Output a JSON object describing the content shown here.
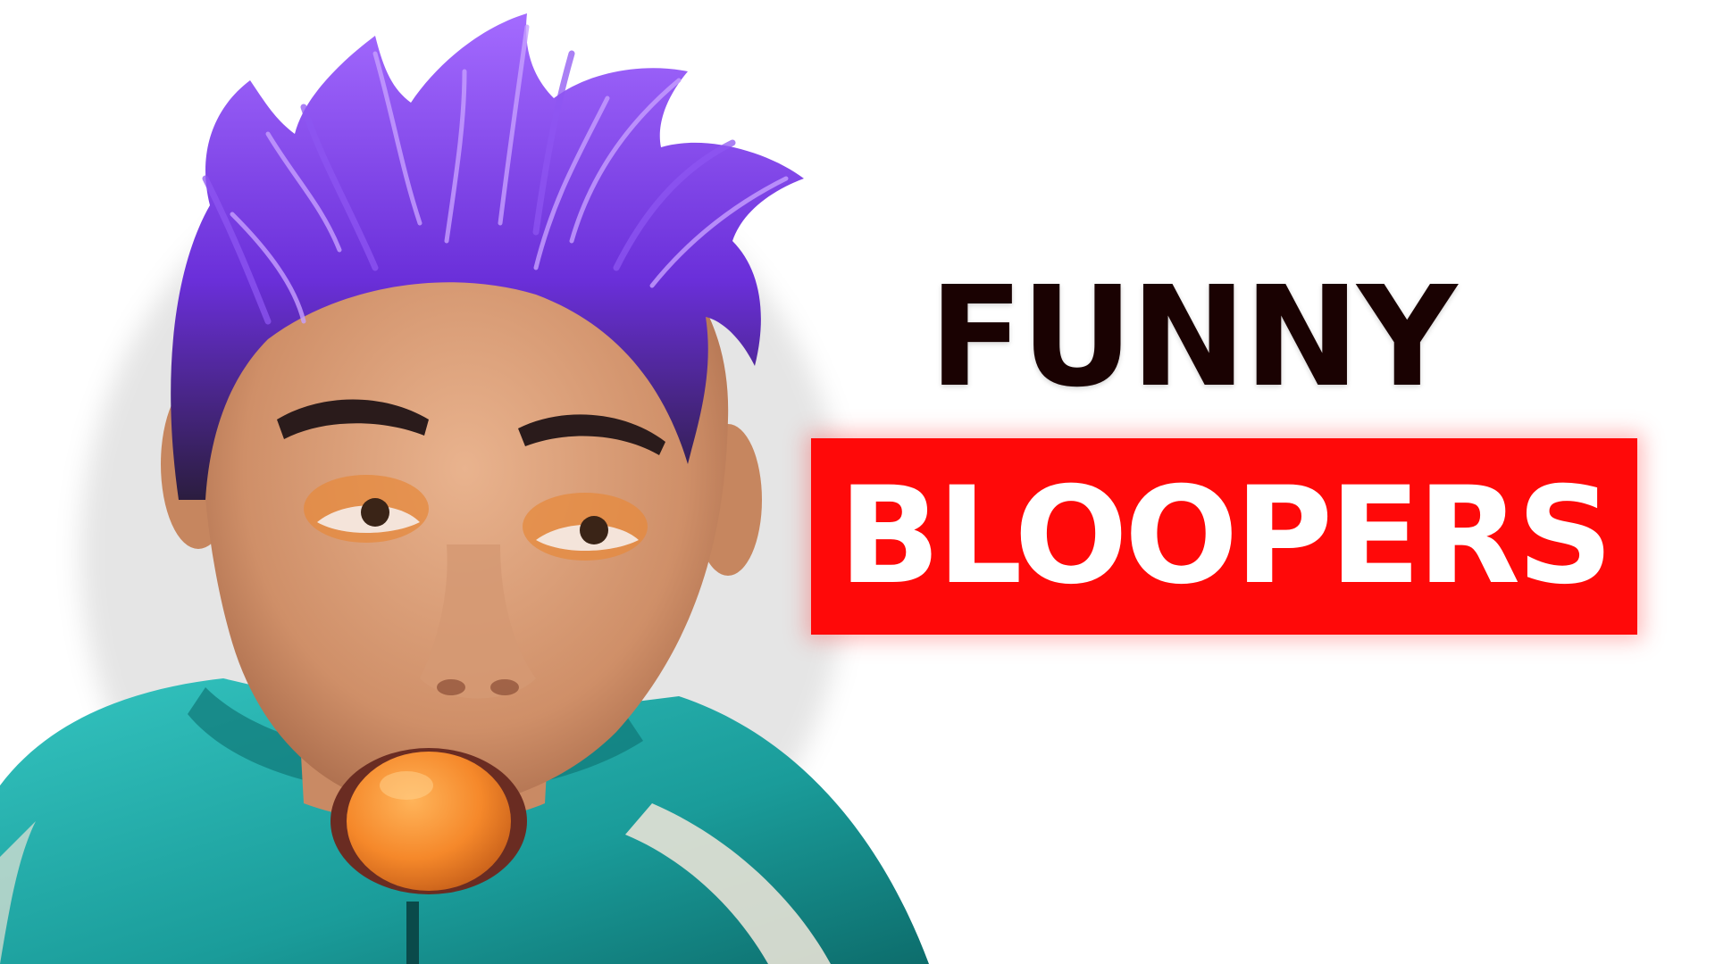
{
  "thumbnail": {
    "title_line1": "FUNNY",
    "title_line2": "BLOOPERS",
    "colors": {
      "background": "#ffffff",
      "title_line1": "#1a0202",
      "banner": "#ff0909",
      "title_line2": "#ffffff",
      "hair": "#7b3fe4",
      "jacket": "#1fa8a6",
      "orange_ball": "#f5882a"
    },
    "icons": {
      "person": "person-photo",
      "mouth_object": "orange-ball"
    }
  }
}
